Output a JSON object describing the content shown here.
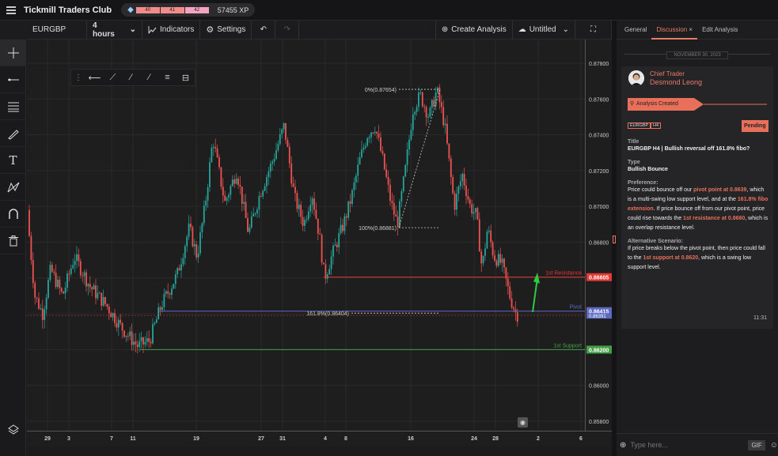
{
  "app": {
    "title": "Tickmill Traders Club",
    "xp_segments": [
      "40",
      "41",
      "42"
    ],
    "xp_value": "57455 XP"
  },
  "toolbar": {
    "symbol": "EURGBP",
    "timeframe": "4 hours",
    "indicators": "Indicators",
    "settings": "Settings",
    "create": "Create Analysis",
    "untitled": "Untitled"
  },
  "chart": {
    "y_ticks": [
      "0.87800",
      "0.87600",
      "0.87400",
      "0.87200",
      "0.87000",
      "0.86800",
      "0.86600",
      "0.86400",
      "0.86200",
      "0.86000",
      "0.85800"
    ],
    "x_ticks": [
      "29",
      "3",
      "7",
      "11",
      "19",
      "27",
      "31",
      "4",
      "8",
      "16",
      "24",
      "28",
      "2",
      "6"
    ],
    "fib_0": "0%(0.87654)",
    "fib_100": "100%(0.86881)",
    "fib_161": "161.8%(0.86404)",
    "resistance_label": "1st Resistance",
    "resistance_value": "0.86605",
    "pivot_label": "Pivot",
    "pivot_value": "0.86415",
    "price_value": "0.86391",
    "support_label": "1st Support",
    "support_value": "0.86200",
    "colors": {
      "resistance": "#e53935",
      "pivot": "#5c6bc0",
      "support": "#43a047",
      "up": "#26a69a",
      "down": "#ef5350",
      "arrow": "#2ecc40"
    }
  },
  "panel": {
    "tabs": [
      "General",
      "Discussion",
      "Edit Analysis"
    ],
    "date": "NOVEMBER 30, 2023",
    "role": "Chief Trader",
    "name": "Desmond Leong",
    "event": "Analysis Created",
    "tags": [
      "EURGBP",
      "H4"
    ],
    "status": "Pending",
    "title_label": "Title",
    "title": "EURGBP H4 | Bullish reversal off 161.8% fibo?",
    "type_label": "Type",
    "type": "Bullish Bounce",
    "pref_label": "Preference:",
    "pref": [
      "Price could bounce off our ",
      "pivot point at 0.8639",
      ", which is a multi-swing low support level, and at the ",
      "161.8% fibo extension",
      ". If price bounce off from our pivot point, price could rise towards the ",
      "1st resistance at 0.8660",
      ", which is an overlap resistance level."
    ],
    "alt_label": "Alternative Scenario:",
    "alt": [
      "If price breaks below the pivot point, then price could fall to the ",
      "1st support at 0.8620",
      ", which is a swing low support level."
    ],
    "time": "11:31",
    "placeholder": "Type here...",
    "gif": "GIF"
  }
}
